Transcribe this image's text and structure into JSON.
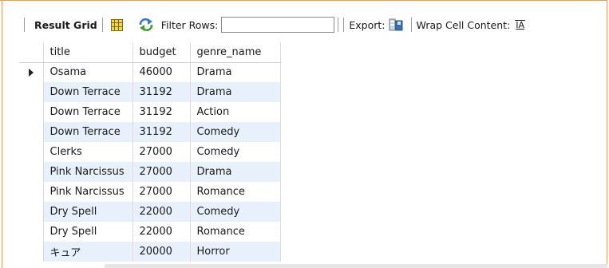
{
  "toolbar": {
    "result_grid_label": "Result Grid",
    "filter_label": "Filter Rows:",
    "filter_value": "",
    "export_label": "Export:",
    "wrap_label": "Wrap Cell Content:",
    "wrap_icon_text": "IA"
  },
  "table": {
    "columns": [
      "title",
      "budget",
      "genre_name"
    ],
    "rows": [
      [
        "Osama",
        "46000",
        "Drama"
      ],
      [
        "Down Terrace",
        "31192",
        "Drama"
      ],
      [
        "Down Terrace",
        "31192",
        "Action"
      ],
      [
        "Down Terrace",
        "31192",
        "Comedy"
      ],
      [
        "Clerks",
        "27000",
        "Comedy"
      ],
      [
        "Pink Narcissus",
        "27000",
        "Drama"
      ],
      [
        "Pink Narcissus",
        "27000",
        "Romance"
      ],
      [
        "Dry Spell",
        "22000",
        "Comedy"
      ],
      [
        "Dry Spell",
        "22000",
        "Romance"
      ],
      [
        "キュア",
        "20000",
        "Horror"
      ]
    ],
    "current_row_index": 0
  },
  "icons": {
    "grid": "result-grid-icon",
    "refresh": "refresh-icon",
    "export": "export-icon",
    "wrap": "wrap-cell-icon",
    "pointer": "current-row-pointer-icon"
  },
  "colors": {
    "row_alt_bg": "#e8f0fb",
    "frame_border": "#d9a36a"
  }
}
